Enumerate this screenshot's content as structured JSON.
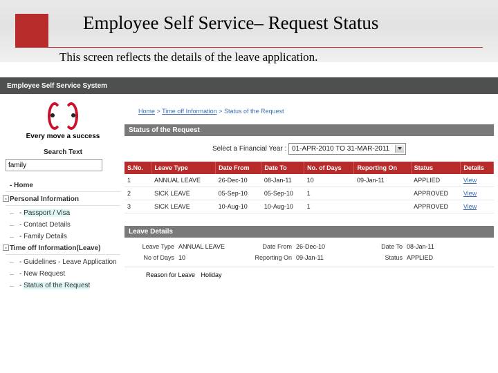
{
  "slide": {
    "title": "Employee Self Service– Request Status",
    "subtitle": "This screen reflects the details of the leave application."
  },
  "app_header": "Employee Self Service System",
  "tagline": "Every move a success",
  "search": {
    "label": "Search Text",
    "value": "family"
  },
  "tree": {
    "home": "Home",
    "pi": "Personal Information",
    "pi_items": [
      "Passport / Visa",
      "Contact Details",
      "Family Details"
    ],
    "toi": "Time off Information(Leave)",
    "toi_items": [
      "Guidelines - Leave Application",
      "New Request",
      "Status of the Request"
    ]
  },
  "breadcrumb": {
    "a": "Home",
    "b": "Time off Information",
    "c": "Status of the Request"
  },
  "section_status": "Status of the Request",
  "fy_label": "Select a Financial Year :",
  "fy_selected": "01-APR-2010 TO 31-MAR-2011",
  "table": {
    "headers": [
      "S.No.",
      "Leave Type",
      "Date From",
      "Date To",
      "No. of Days",
      "Reporting On",
      "Status",
      "Details"
    ],
    "rows": [
      {
        "n": "1",
        "lt": "ANNUAL LEAVE",
        "df": "26-Dec-10",
        "dt": "08-Jan-11",
        "nd": "10",
        "ro": "09-Jan-11",
        "st": "APPLIED",
        "dl": "View"
      },
      {
        "n": "2",
        "lt": "SICK LEAVE",
        "df": "05-Sep-10",
        "dt": "05-Sep-10",
        "nd": "1",
        "ro": "",
        "st": "APPROVED",
        "dl": "View"
      },
      {
        "n": "3",
        "lt": "SICK LEAVE",
        "df": "10-Aug-10",
        "dt": "10-Aug-10",
        "nd": "1",
        "ro": "",
        "st": "APPROVED",
        "dl": "View"
      }
    ]
  },
  "leave_details": {
    "title": "Leave Details",
    "labels": {
      "lt": "Leave Type",
      "df": "Date From",
      "dt": "Date To",
      "nd": "No of Days",
      "ro": "Reporting On",
      "st": "Status",
      "rl": "Reason for Leave"
    },
    "lt": "ANNUAL LEAVE",
    "df": "26-Dec-10",
    "dt": "08-Jan-11",
    "nd": "10",
    "ro": "09-Jan-11",
    "st": "APPLIED",
    "rl": "Holiday"
  }
}
